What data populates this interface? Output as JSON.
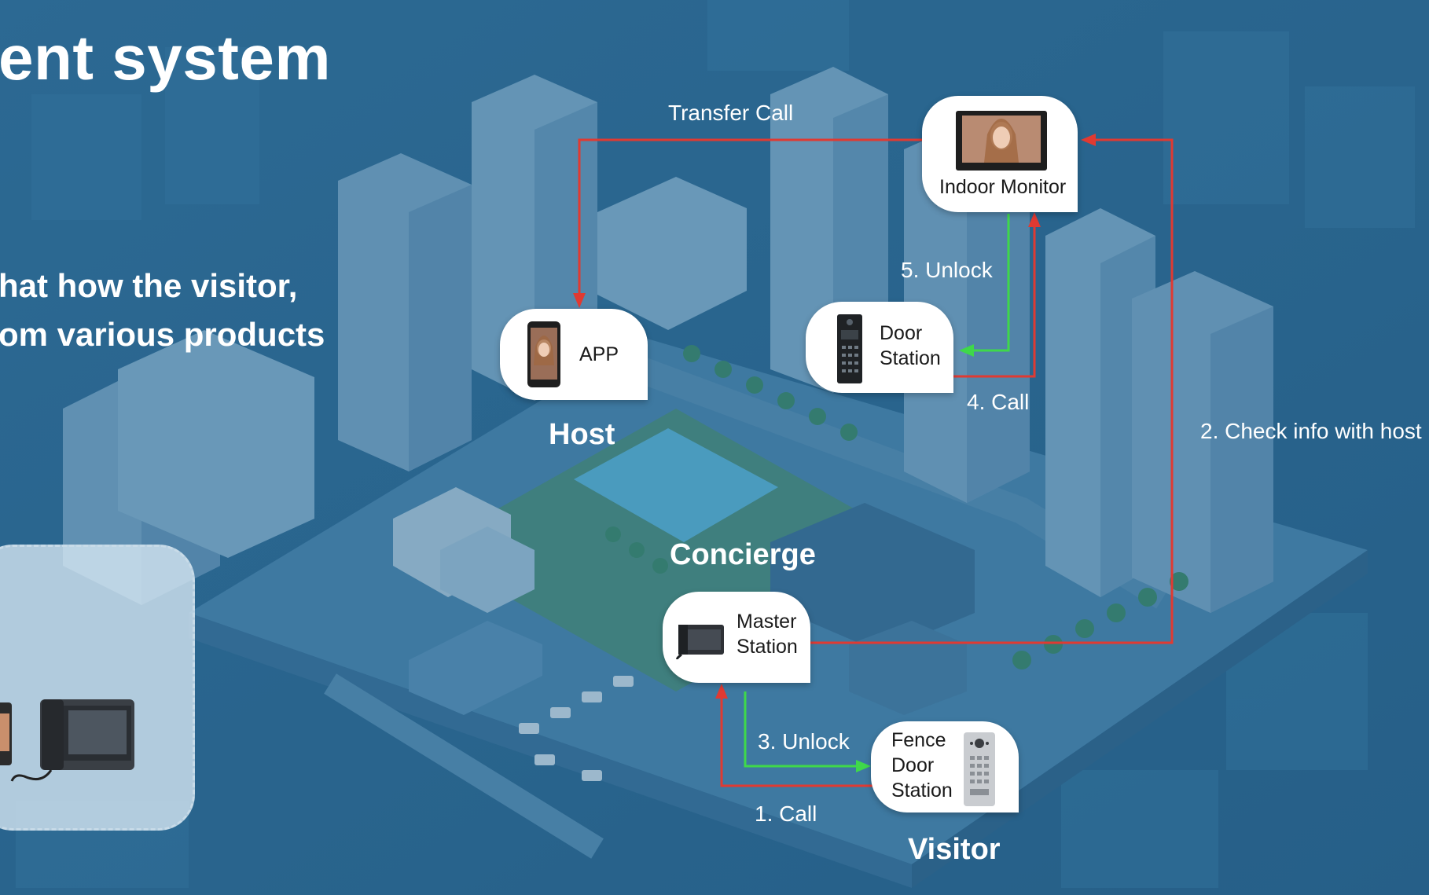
{
  "heading": {
    "title": "ent system",
    "subtitle_line1": "hat how the visitor,",
    "subtitle_line2": "om various products"
  },
  "nodes": {
    "indoor_monitor": "Indoor Monitor",
    "app": "APP",
    "door_station_line1": "Door",
    "door_station_line2": "Station",
    "master_station_line1": "Master",
    "master_station_line2": "Station",
    "fence_line1": "Fence",
    "fence_line2": "Door",
    "fence_line3": "Station"
  },
  "roles": {
    "host": "Host",
    "concierge": "Concierge",
    "visitor": "Visitor"
  },
  "flows": {
    "transfer_call": "Transfer Call",
    "unlock_5": "5. Unlock",
    "call_4": "4. Call",
    "check_info_2": "2. Check info with host",
    "unlock_3": "3. Unlock",
    "call_1": "1. Call"
  },
  "colors": {
    "call_line": "#e03a32",
    "unlock_line": "#3fd84a",
    "background": "#2f6d95"
  }
}
